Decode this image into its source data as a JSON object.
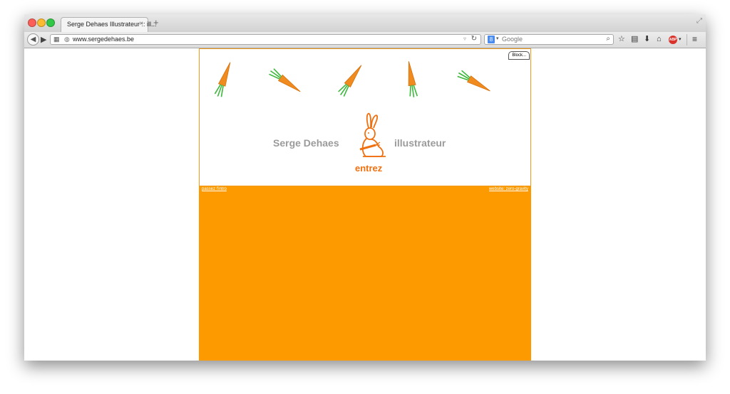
{
  "browser": {
    "tab_title": "Serge Dehaes Illustrateur :: ill...",
    "tab_close": "×",
    "new_tab": "+",
    "url": "www.sergedehaes.be",
    "search_engine_badge": "8",
    "search_placeholder": "Google",
    "toolbar_icons": [
      "star-icon",
      "reading-list-icon",
      "download-icon",
      "home-icon",
      "adblock-icon",
      "menu-icon"
    ],
    "adblock_label": "ABP"
  },
  "site": {
    "block_label": "Block...",
    "name_left": "Serge Dehaes",
    "name_right": "illustrateur",
    "enter_label": "entrez",
    "skip_intro_link": "passez l'intro",
    "website_link": "website: zero-gravity",
    "colors": {
      "accent_orange": "#fd9a00",
      "title_gray": "#9b9b9b",
      "enter_orange": "#f07010",
      "leaf_green": "#3cb83c"
    }
  }
}
